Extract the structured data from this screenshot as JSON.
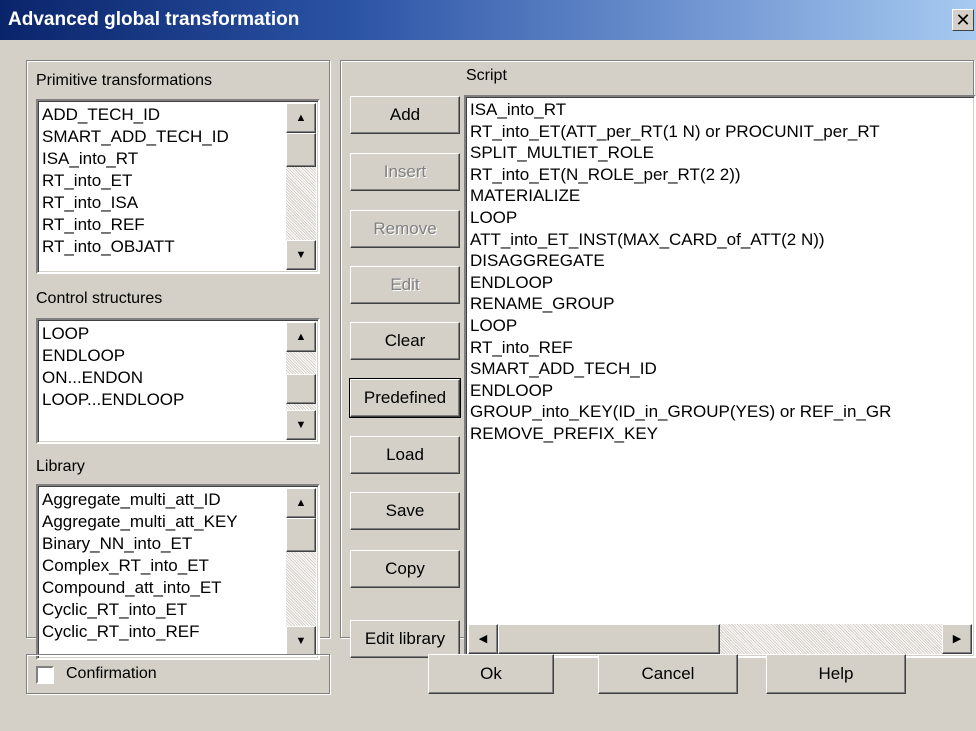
{
  "window": {
    "title": "Advanced global transformation",
    "close_glyph": "✕"
  },
  "primitive": {
    "label": "Primitive transformations",
    "items": [
      "ADD_TECH_ID",
      "SMART_ADD_TECH_ID",
      "ISA_into_RT",
      "RT_into_ET",
      "RT_into_ISA",
      "RT_into_REF",
      "RT_into_OBJATT"
    ]
  },
  "control": {
    "label": "Control structures",
    "items": [
      "LOOP",
      "ENDLOOP",
      "ON...ENDON",
      "LOOP...ENDLOOP"
    ]
  },
  "library": {
    "label": "Library",
    "items": [
      "Aggregate_multi_att_ID",
      "Aggregate_multi_att_KEY",
      "Binary_NN_into_ET",
      "Complex_RT_into_ET",
      "Compound_att_into_ET",
      "Cyclic_RT_into_ET",
      "Cyclic_RT_into_REF"
    ]
  },
  "buttons": {
    "add": "Add",
    "insert": "Insert",
    "remove": "Remove",
    "edit": "Edit",
    "clear": "Clear",
    "predefined": "Predefined",
    "load": "Load",
    "save": "Save",
    "copy": "Copy",
    "edit_library": "Edit library"
  },
  "script": {
    "label": "Script",
    "lines": [
      "ISA_into_RT",
      "RT_into_ET(ATT_per_RT(1 N) or PROCUNIT_per_RT",
      "SPLIT_MULTIET_ROLE",
      "RT_into_ET(N_ROLE_per_RT(2 2))",
      "MATERIALIZE",
      "LOOP",
      "  ATT_into_ET_INST(MAX_CARD_of_ATT(2 N))",
      "  DISAGGREGATE",
      "ENDLOOP",
      "RENAME_GROUP",
      "LOOP",
      "  RT_into_REF",
      "  SMART_ADD_TECH_ID",
      "ENDLOOP",
      "GROUP_into_KEY(ID_in_GROUP(YES) or REF_in_GR",
      "REMOVE_PREFIX_KEY"
    ]
  },
  "footer": {
    "confirmation_label": "Confirmation",
    "confirmation_checked": false,
    "ok": "Ok",
    "cancel": "Cancel",
    "help": "Help"
  },
  "icons": {
    "scroll_up": "▲",
    "scroll_down": "▼",
    "scroll_left": "◀",
    "scroll_right": "▶"
  }
}
